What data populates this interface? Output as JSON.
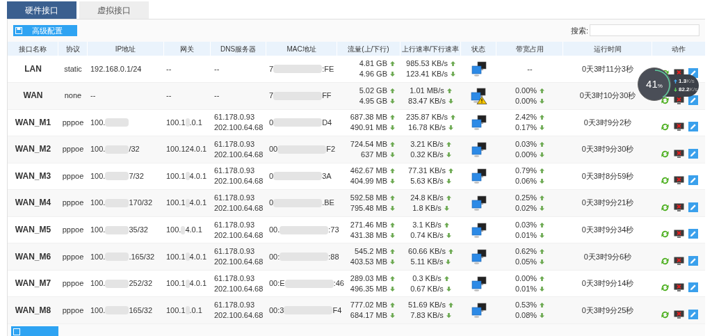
{
  "tabs": [
    {
      "label": "硬件接口",
      "selected": true
    },
    {
      "label": "虚拟接口",
      "selected": false
    }
  ],
  "toolbar": {
    "button": "高级配置",
    "search_label": "搜索:"
  },
  "columns": [
    "接口名称",
    "协议",
    "IP地址",
    "网关",
    "DNS服务器",
    "MAC地址",
    "流量(上/下行)",
    "上行速率/下行速率",
    "状态",
    "带宽占用",
    "运行时间",
    "动作"
  ],
  "rows": [
    {
      "name": "LAN",
      "protocol": "static",
      "ip": {
        "head": "192.168.0.1/24",
        "blurred": false
      },
      "gateway": {
        "head": "--",
        "blurred": false
      },
      "dns": [
        "--"
      ],
      "mac": {
        "head": "7",
        "tail": ":FE",
        "blurred": true
      },
      "traffic": [
        {
          "text": "4.81 GB",
          "kind": "up"
        },
        {
          "text": "4.96 GB",
          "kind": "down"
        }
      ],
      "rate": [
        {
          "text": "985.53 KB/s",
          "kind": "up"
        },
        {
          "text": "123.41 KB/s",
          "kind": "down"
        }
      ],
      "warning": false,
      "bandwidth": [
        {
          "text": "--",
          "kind": "plain"
        }
      ],
      "uptime": "0天3时11分3秒"
    },
    {
      "name": "WAN",
      "protocol": "none",
      "ip": {
        "head": "--",
        "blurred": false
      },
      "gateway": {
        "head": "--",
        "blurred": false
      },
      "dns": [
        "--"
      ],
      "mac": {
        "head": "7",
        "tail": "FF",
        "blurred": true
      },
      "traffic": [
        {
          "text": "5.02 GB",
          "kind": "up"
        },
        {
          "text": "4.95 GB",
          "kind": "down"
        }
      ],
      "rate": [
        {
          "text": "1.01 MB/s",
          "kind": "up"
        },
        {
          "text": "83.47 KB/s",
          "kind": "down"
        }
      ],
      "warning": true,
      "bandwidth": [
        {
          "text": "0.00%",
          "kind": "up"
        },
        {
          "text": "0.00%",
          "kind": "down"
        }
      ],
      "uptime": "0天3时10分30秒"
    },
    {
      "name": "WAN_M1",
      "protocol": "pppoe",
      "ip": {
        "head": "100.",
        "blurred": true
      },
      "gateway": {
        "head": "100.1",
        "tail": ".0.1",
        "blurred": true
      },
      "dns": [
        "61.178.0.93",
        "202.100.64.68"
      ],
      "mac": {
        "head": "0",
        "tail": "D4",
        "blurred": true
      },
      "traffic": [
        {
          "text": "687.38 MB",
          "kind": "up"
        },
        {
          "text": "490.91 MB",
          "kind": "down"
        }
      ],
      "rate": [
        {
          "text": "235.87 KB/s",
          "kind": "up"
        },
        {
          "text": "16.78 KB/s",
          "kind": "down"
        }
      ],
      "warning": false,
      "bandwidth": [
        {
          "text": "2.42%",
          "kind": "up"
        },
        {
          "text": "0.17%",
          "kind": "down"
        }
      ],
      "uptime": "0天3时9分2秒"
    },
    {
      "name": "WAN_M2",
      "protocol": "pppoe",
      "ip": {
        "head": "100.",
        "tail": "/32",
        "blurred": true
      },
      "gateway": {
        "head": "100.124.0.1",
        "blurred": false
      },
      "dns": [
        "61.178.0.93",
        "202.100.64.68"
      ],
      "mac": {
        "head": "00",
        "tail": "F2",
        "blurred": true
      },
      "traffic": [
        {
          "text": "724.54 MB",
          "kind": "up"
        },
        {
          "text": "637 MB",
          "kind": "down"
        }
      ],
      "rate": [
        {
          "text": "3.21 KB/s",
          "kind": "up"
        },
        {
          "text": "0.32 KB/s",
          "kind": "down"
        }
      ],
      "warning": false,
      "bandwidth": [
        {
          "text": "0.03%",
          "kind": "up"
        },
        {
          "text": "0.00%",
          "kind": "down"
        }
      ],
      "uptime": "0天3时9分30秒"
    },
    {
      "name": "WAN_M3",
      "protocol": "pppoe",
      "ip": {
        "head": "100.",
        "tail": "7/32",
        "blurred": true
      },
      "gateway": {
        "head": "100.1",
        "tail": "4.0.1",
        "blurred": true
      },
      "dns": [
        "61.178.0.93",
        "202.100.64.68"
      ],
      "mac": {
        "head": "0",
        "tail": "3A",
        "blurred": true
      },
      "traffic": [
        {
          "text": "462.67 MB",
          "kind": "up"
        },
        {
          "text": "404.99 MB",
          "kind": "down"
        }
      ],
      "rate": [
        {
          "text": "77.31 KB/s",
          "kind": "up"
        },
        {
          "text": "5.63 KB/s",
          "kind": "down"
        }
      ],
      "warning": false,
      "bandwidth": [
        {
          "text": "0.79%",
          "kind": "up"
        },
        {
          "text": "0.06%",
          "kind": "down"
        }
      ],
      "uptime": "0天3时8分59秒"
    },
    {
      "name": "WAN_M4",
      "protocol": "pppoe",
      "ip": {
        "head": "100.",
        "tail": "170/32",
        "blurred": true
      },
      "gateway": {
        "head": "100.1",
        "tail": "4.0.1",
        "blurred": true
      },
      "dns": [
        "61.178.0.93",
        "202.100.64.68"
      ],
      "mac": {
        "head": "0",
        "tail": ".BE",
        "blurred": true
      },
      "traffic": [
        {
          "text": "592.58 MB",
          "kind": "up"
        },
        {
          "text": "795.48 MB",
          "kind": "down"
        }
      ],
      "rate": [
        {
          "text": "24.8 KB/s",
          "kind": "up"
        },
        {
          "text": "1.8 KB/s",
          "kind": "down"
        }
      ],
      "warning": false,
      "bandwidth": [
        {
          "text": "0.25%",
          "kind": "up"
        },
        {
          "text": "0.02%",
          "kind": "down"
        }
      ],
      "uptime": "0天3时9分21秒"
    },
    {
      "name": "WAN_M5",
      "protocol": "pppoe",
      "ip": {
        "head": "100.",
        "tail": "35/32",
        "blurred": true
      },
      "gateway": {
        "head": "100.",
        "tail": "4.0.1",
        "blurred": true
      },
      "dns": [
        "61.178.0.93",
        "202.100.64.68"
      ],
      "mac": {
        "head": "00.",
        "tail": ":73",
        "blurred": true
      },
      "traffic": [
        {
          "text": "271.46 MB",
          "kind": "up"
        },
        {
          "text": "431.38 MB",
          "kind": "down"
        }
      ],
      "rate": [
        {
          "text": "3.1 KB/s",
          "kind": "up"
        },
        {
          "text": "0.74 KB/s",
          "kind": "down"
        }
      ],
      "warning": false,
      "bandwidth": [
        {
          "text": "0.03%",
          "kind": "up"
        },
        {
          "text": "0.01%",
          "kind": "down"
        }
      ],
      "uptime": "0天3时9分34秒"
    },
    {
      "name": "WAN_M6",
      "protocol": "pppoe",
      "ip": {
        "head": "100.",
        "tail": ".165/32",
        "blurred": true
      },
      "gateway": {
        "head": "100.1",
        "tail": "4.0.1",
        "blurred": true
      },
      "dns": [
        "61.178.0.93",
        "202.100.64.68"
      ],
      "mac": {
        "head": "00:",
        "tail": ":88",
        "blurred": true
      },
      "traffic": [
        {
          "text": "545.2 MB",
          "kind": "up"
        },
        {
          "text": "403.53 MB",
          "kind": "down"
        }
      ],
      "rate": [
        {
          "text": "60.66 KB/s",
          "kind": "up"
        },
        {
          "text": "5.11 KB/s",
          "kind": "down"
        }
      ],
      "warning": false,
      "bandwidth": [
        {
          "text": "0.62%",
          "kind": "up"
        },
        {
          "text": "0.05%",
          "kind": "down"
        }
      ],
      "uptime": "0天3时9分6秒"
    },
    {
      "name": "WAN_M7",
      "protocol": "pppoe",
      "ip": {
        "head": "100.",
        "tail": "252/32",
        "blurred": true
      },
      "gateway": {
        "head": "100.1",
        "tail": "4.0.1",
        "blurred": true
      },
      "dns": [
        "61.178.0.93",
        "202.100.64.68"
      ],
      "mac": {
        "head": "00:E",
        "tail": ":46",
        "blurred": true
      },
      "traffic": [
        {
          "text": "289.03 MB",
          "kind": "up"
        },
        {
          "text": "496.35 MB",
          "kind": "down"
        }
      ],
      "rate": [
        {
          "text": "0.3 KB/s",
          "kind": "up"
        },
        {
          "text": "0.67 KB/s",
          "kind": "down"
        }
      ],
      "warning": false,
      "bandwidth": [
        {
          "text": "0.00%",
          "kind": "up"
        },
        {
          "text": "0.01%",
          "kind": "down"
        }
      ],
      "uptime": "0天3时9分14秒"
    },
    {
      "name": "WAN_M8",
      "protocol": "pppoe",
      "ip": {
        "head": "100.",
        "tail": "165/32",
        "blurred": true
      },
      "gateway": {
        "head": "100.1",
        "tail": ".0.1",
        "blurred": true
      },
      "dns": [
        "61.178.0.93",
        "202.100.64.68"
      ],
      "mac": {
        "head": "00:3",
        "tail": "F4",
        "blurred": true
      },
      "traffic": [
        {
          "text": "777.02 MB",
          "kind": "up"
        },
        {
          "text": "684.17 MB",
          "kind": "down"
        }
      ],
      "rate": [
        {
          "text": "51.69 KB/s",
          "kind": "up"
        },
        {
          "text": "7.83 KB/s",
          "kind": "down"
        }
      ],
      "warning": false,
      "bandwidth": [
        {
          "text": "0.53%",
          "kind": "up"
        },
        {
          "text": "0.08%",
          "kind": "down"
        }
      ],
      "uptime": "0天3时9分25秒"
    }
  ],
  "speed_widget": {
    "percent": "41",
    "unit": "%",
    "up": "1.3",
    "up_unit": "K/s",
    "down": "82.2",
    "down_unit": "K/s",
    "level": 0.41
  }
}
